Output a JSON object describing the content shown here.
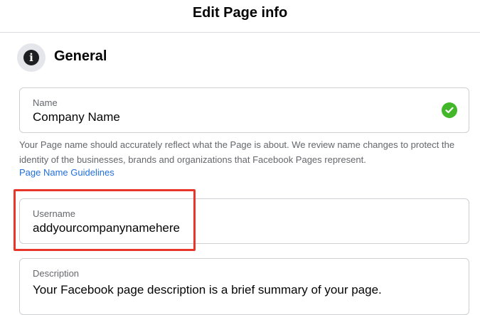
{
  "header": {
    "title": "Edit Page info"
  },
  "section": {
    "title": "General",
    "icon": "info-icon"
  },
  "fields": {
    "name": {
      "label": "Name",
      "value": "Company Name",
      "status_icon": "check-circle-icon",
      "status_color": "#42b72a"
    },
    "username": {
      "label": "Username",
      "value": "addyourcompanynamehere"
    },
    "description": {
      "label": "Description",
      "value": "Your Facebook page description is a brief summary of your page."
    }
  },
  "help": {
    "text": "Your Page name should accurately reflect what the Page is about. We review name changes to protect the identity of the businesses, brands and organizations that Facebook Pages represent.",
    "link_label": "Page Name Guidelines"
  },
  "colors": {
    "link": "#216fdb",
    "highlight": "#e8372a"
  }
}
